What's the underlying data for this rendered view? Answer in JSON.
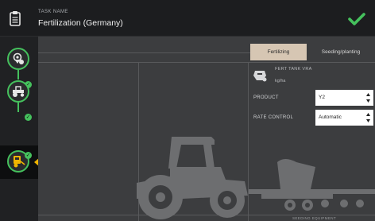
{
  "header": {
    "label": "TASK NAME",
    "task_name": "Fertilization (Germany)",
    "task_icon": "clipboard-icon",
    "confirm_icon": "checkmark-icon"
  },
  "sidebar": {
    "steps": [
      {
        "icon": "field-location-icon",
        "status": "done"
      },
      {
        "icon": "tractor-icon",
        "status": "done"
      },
      {
        "icon": "implement-icon",
        "status": "active"
      }
    ],
    "badge_mark": "✓"
  },
  "tabs": [
    {
      "label": "Fertilizing",
      "active": true
    },
    {
      "label": "Seeding/planting",
      "active": false
    }
  ],
  "tank": {
    "name": "FERT TANK VRA",
    "unit": "kg/ha",
    "icon": "fertilizer-tank-icon"
  },
  "fields": [
    {
      "label": "PRODUCT",
      "value": "Y2"
    },
    {
      "label": "RATE CONTROL",
      "value": "Automatic"
    }
  ],
  "seeder_caption": "SEEDING EQUIPMENT",
  "colors": {
    "accent_green": "#45c15d",
    "active_tab": "#d6c6b3",
    "active_marker": "#f0b400"
  }
}
